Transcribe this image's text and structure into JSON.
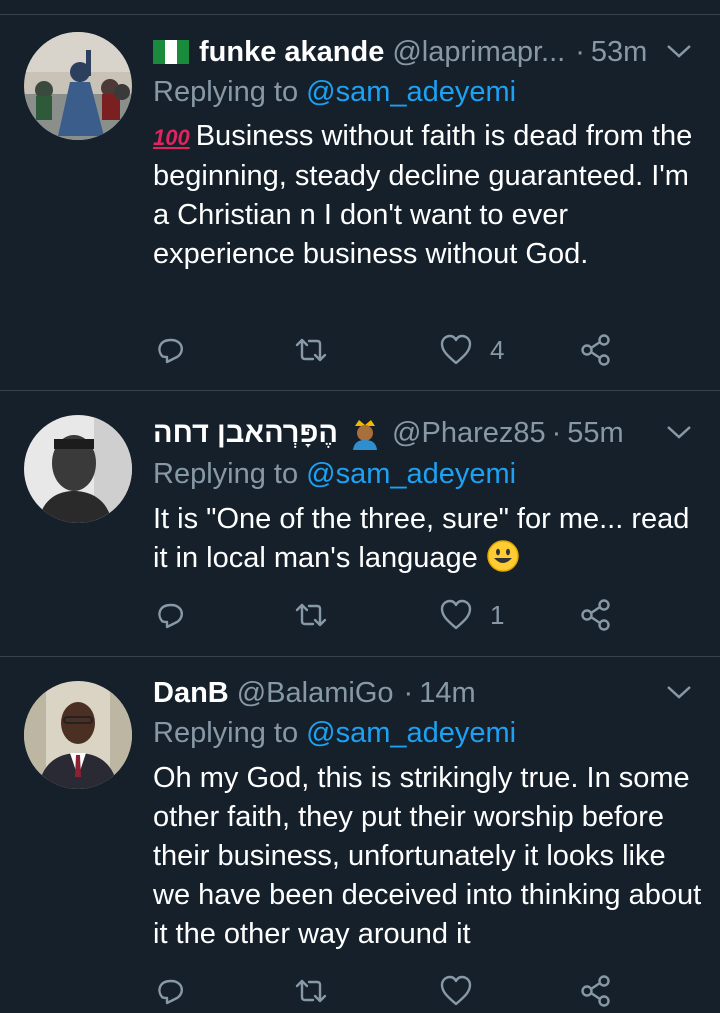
{
  "tweets": [
    {
      "name": "funke akande",
      "handle": "@laprimapr...",
      "dot": "·",
      "time": "53m",
      "reply_prefix": "Replying to",
      "reply_to": "@sam_adeyemi",
      "emoji_100": "100",
      "text": "Business without faith is dead from the beginning, steady decline guaranteed. I'm a Christian n I don't want to ever experience business without God.",
      "like_count": "4"
    },
    {
      "name": "הֶפָּרְהאבן דחה",
      "handle": "@Pharez85",
      "dot": "·",
      "time": "55m",
      "reply_prefix": "Replying to",
      "reply_to": "@sam_adeyemi",
      "text": "It is \"One of the three, sure\" for me... read it in local man's language",
      "like_count": "1"
    },
    {
      "name": "DanB",
      "handle": "@BalamiGo",
      "dot": "·",
      "time": "14m",
      "reply_prefix": "Replying to",
      "reply_to": "@sam_adeyemi",
      "text": "Oh my God, this is strikingly true. In some other faith, they put their worship before their business, unfortunately it looks like we have been deceived into thinking about it the other way around it"
    }
  ],
  "icons": [
    "reply-icon",
    "retweet-icon",
    "like-icon",
    "share-icon",
    "chevron-down-icon"
  ],
  "colors": {
    "background": "#15202b",
    "secondary_text": "#8899a6",
    "link": "#1da1f2",
    "divider": "#38444d"
  }
}
